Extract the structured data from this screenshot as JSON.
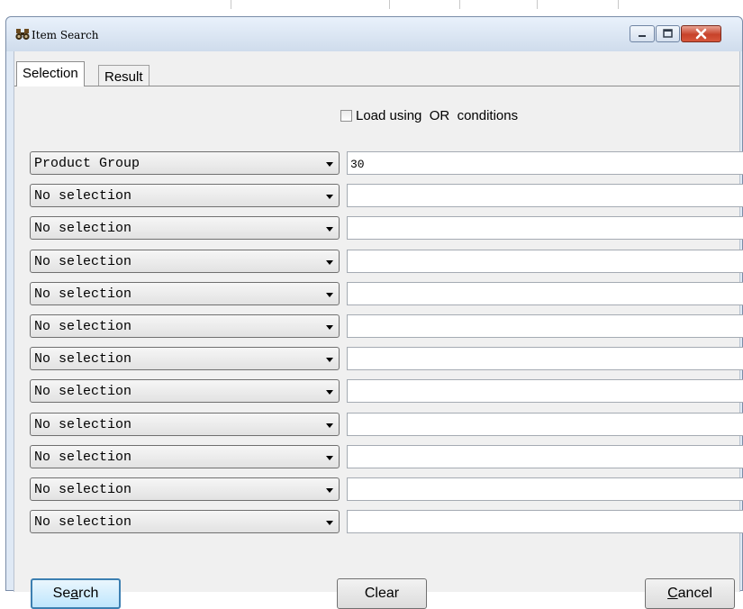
{
  "window": {
    "title": "Item Search"
  },
  "colors": {
    "accent": "#3c7fb1",
    "close": "#c7422a",
    "titlebar": "#dfe9f5"
  },
  "tabs": [
    {
      "label": "Selection",
      "active": true
    },
    {
      "label": "Result",
      "active": false
    }
  ],
  "or_conditions": {
    "label": "Load using  OR  conditions",
    "checked": false
  },
  "criteria": [
    {
      "field": "Product Group",
      "value": "30"
    },
    {
      "field": "No selection",
      "value": ""
    },
    {
      "field": "No selection",
      "value": ""
    },
    {
      "field": "No selection",
      "value": ""
    },
    {
      "field": "No selection",
      "value": ""
    },
    {
      "field": "No selection",
      "value": ""
    },
    {
      "field": "No selection",
      "value": ""
    },
    {
      "field": "No selection",
      "value": ""
    },
    {
      "field": "No selection",
      "value": ""
    },
    {
      "field": "No selection",
      "value": ""
    },
    {
      "field": "No selection",
      "value": ""
    },
    {
      "field": "No selection",
      "value": ""
    }
  ],
  "buttons": {
    "search": {
      "pre": "Se",
      "mnemonic": "a",
      "post": "rch"
    },
    "clear": "Clear",
    "cancel": {
      "pre": "",
      "mnemonic": "C",
      "post": "ancel"
    }
  },
  "icons": {
    "app": "binoculars-icon",
    "minimize": "minimize-icon",
    "maximize": "maximize-icon",
    "close": "close-icon",
    "dropdown": "dropdown-arrow-icon"
  }
}
